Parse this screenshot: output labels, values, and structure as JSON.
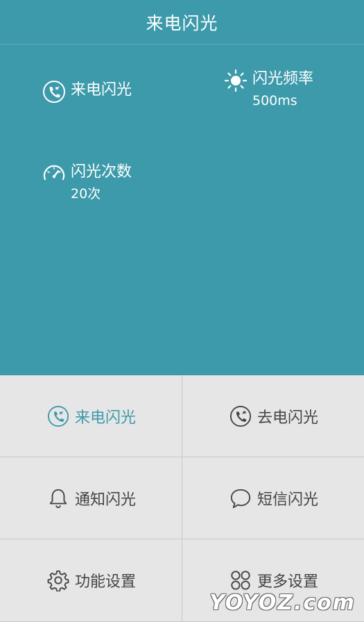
{
  "header": {
    "title": "来电闪光"
  },
  "stats": {
    "call": {
      "label": "来电闪光",
      "icon": "phone-incoming-icon"
    },
    "frequency": {
      "label": "闪光频率",
      "value": "500ms",
      "icon": "sun-icon"
    },
    "count": {
      "label": "闪光次数",
      "value": "20次",
      "icon": "speedometer-icon"
    }
  },
  "menu": [
    {
      "label": "来电闪光",
      "icon": "phone-incoming-icon",
      "active": true
    },
    {
      "label": "去电闪光",
      "icon": "phone-outgoing-icon",
      "active": false
    },
    {
      "label": "通知闪光",
      "icon": "bell-icon",
      "active": false
    },
    {
      "label": "短信闪光",
      "icon": "chat-bubble-icon",
      "active": false
    },
    {
      "label": "功能设置",
      "icon": "gear-icon",
      "active": false
    },
    {
      "label": "更多设置",
      "icon": "grid-circles-icon",
      "active": false
    }
  ],
  "colors": {
    "primary": "#3d9aaa",
    "menu_bg": "#e6e6e6",
    "menu_text": "#444444"
  },
  "watermark": "YOYOZ.com"
}
